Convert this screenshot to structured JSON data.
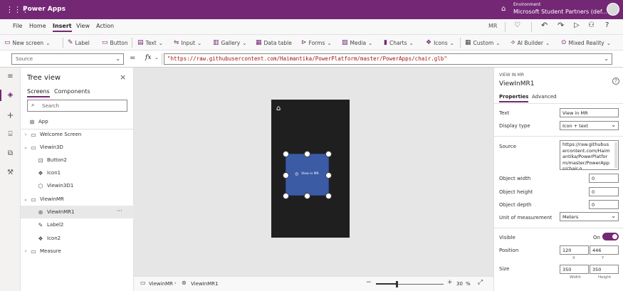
{
  "topbar": {
    "app_name": "Power Apps",
    "env_label": "Environment",
    "env_name": "Microsoft Student Partners (def..."
  },
  "menubar": {
    "items": [
      "File",
      "Home",
      "Insert",
      "View",
      "Action"
    ],
    "active": "Insert",
    "user_initials": "MR"
  },
  "toolbar": {
    "items": [
      "New screen",
      "Label",
      "Button",
      "Text",
      "Input",
      "Gallery",
      "Data table",
      "Forms",
      "Media",
      "Charts",
      "Icons",
      "Custom",
      "AI Builder",
      "Mixed Reality"
    ]
  },
  "formula": {
    "property": "Source",
    "fx": "fx",
    "equals": "=",
    "value": "\"https://raw.githubusercontent.com/Haimantika/PowerPlatform/master/PowerApps/chair.glb\""
  },
  "treeview": {
    "title": "Tree view",
    "tabs": [
      "Screens",
      "Components"
    ],
    "search_placeholder": "Search",
    "app_label": "App",
    "rows": [
      {
        "label": "Welcome Screen"
      },
      {
        "label": "Viewin3D"
      },
      {
        "label": "Button2"
      },
      {
        "label": "Icon1"
      },
      {
        "label": "Viewin3D1"
      },
      {
        "label": "ViewinMR"
      },
      {
        "label": "ViewInMR1"
      },
      {
        "label": "Label2"
      },
      {
        "label": "Icon2"
      },
      {
        "label": "Measure"
      }
    ],
    "more": "···"
  },
  "canvas": {
    "button_label": "View in MR"
  },
  "statusbar": {
    "screen": "ViewinMR",
    "control": "ViewInMR1",
    "zoom": "30",
    "zoom_unit": "%",
    "zoom_level": 0.3
  },
  "props": {
    "type_label": "VIEW IN MR",
    "control_name": "ViewInMR1",
    "tabs": [
      "Properties",
      "Advanced"
    ],
    "text_label": "Text",
    "text_value": "View in MR",
    "display_type_label": "Display type",
    "display_type_value": "Icon + text",
    "source_label": "Source",
    "source_value": "https://raw.githubusercontent.com/Haimantika/PowerPlatform/master/PowerApps/chair.g",
    "object_width_label": "Object width",
    "object_width_value": "0",
    "object_height_label": "Object height",
    "object_height_value": "0",
    "object_depth_label": "Object depth",
    "object_depth_value": "0",
    "unit_label": "Unit of measurement",
    "unit_value": "Meters",
    "visible_label": "Visible",
    "visible_state": "On",
    "position_label": "Position",
    "pos_x": "120",
    "pos_y": "446",
    "x_label": "X",
    "y_label": "Y",
    "size_label": "Size",
    "width": "350",
    "height": "350",
    "width_label": "Width",
    "height_label": "Height"
  },
  "colors": {
    "brand": "#742774",
    "button_blue": "#3b5ba5",
    "phone_bg": "#1f1f1f"
  }
}
